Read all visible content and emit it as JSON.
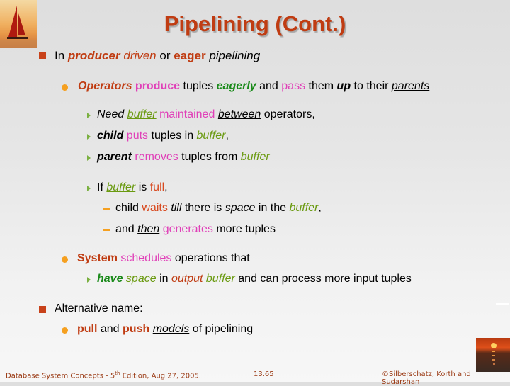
{
  "slide": {
    "title": "Pipelining (Cont.)",
    "logo_top": "sailboat-image",
    "logo_bottom": "sunset-image"
  },
  "bullets": {
    "b1": {
      "t1": "In ",
      "t2": "producer",
      "t3": " ",
      "t4": "driven",
      "t5": " or ",
      "t6": "eager",
      "t7": " ",
      "t8": "pipelining"
    },
    "b1a": {
      "t1": "Operators",
      "t2": " ",
      "t3": "produce",
      "t4": " tuples ",
      "t5": "eagerly",
      "t6": " and ",
      "t7": "pass",
      "t8": " them ",
      "t9": "up",
      "t10": " to their ",
      "t11": "parents"
    },
    "b1a1": {
      "t1": "Need",
      "t2": " ",
      "t3": "buffer",
      "t4": " ",
      "t5": "maintained",
      "t6": " ",
      "t7": "between",
      "t8": " operators,"
    },
    "b1a2": {
      "t1": "child",
      "t2": " ",
      "t3": "puts",
      "t4": " tuples in ",
      "t5": "buffer",
      "t6": ","
    },
    "b1a3": {
      "t1": "parent",
      "t2": " ",
      "t3": "removes",
      "t4": " tuples from ",
      "t5": "buffer"
    },
    "b1a4": {
      "t1": "If ",
      "t2": "buffer",
      "t3": " is ",
      "t4": "full",
      "t5": ","
    },
    "b1a4a": {
      "t1": "child ",
      "t2": "waits",
      "t3": " ",
      "t4": "till",
      "t5": " there is ",
      "t6": "space",
      "t7": " in the ",
      "t8": "buffer",
      "t9": ","
    },
    "b1a4b": {
      "t1": "and ",
      "t2": "then",
      "t3": " ",
      "t4": "generates",
      "t5": " more tuples"
    },
    "b1b": {
      "t1": "System",
      "t2": " ",
      "t3": "schedules",
      "t4": " operations that"
    },
    "b1b1": {
      "t1": "have",
      "t2": " ",
      "t3": "space",
      "t4": " in ",
      "t5": "output",
      "t6": " ",
      "t7": "buffer",
      "t8": " and ",
      "t9": "can",
      "t10": " ",
      "t11": "process",
      "t12": " more input tuples"
    },
    "b2": {
      "t1": "Alternative name:"
    },
    "b2a": {
      "t1": "pull",
      "t2": " and ",
      "t3": "push",
      "t4": " ",
      "t5": "models",
      "t6": " of pipelining"
    }
  },
  "footer": {
    "left_prefix": "Database System Concepts - 5",
    "left_sup": "th",
    "left_suffix": " Edition, Aug 27, 2005.",
    "page": "13.65",
    "right": "©Silberschatz, Korth and Sudarshan"
  }
}
